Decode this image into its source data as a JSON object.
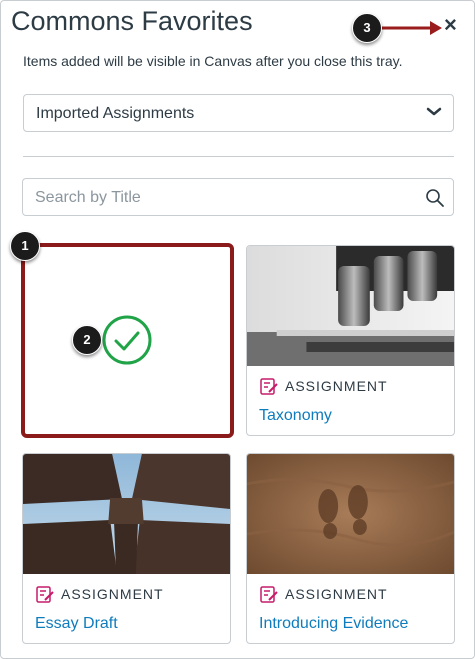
{
  "tray": {
    "title": "Commons Favorites",
    "subtitle": "Items added will be visible in Canvas after you close this tray.",
    "close_label": "×"
  },
  "filter": {
    "selected": "Imported Assignments"
  },
  "search": {
    "placeholder": "Search by Title",
    "value": ""
  },
  "cards": [
    {
      "type": "ASSIGNMENT",
      "title": "Taxonomy",
      "image": "microscope"
    },
    {
      "type": "ASSIGNMENT",
      "title": "Essay Draft",
      "image": "building-sky"
    },
    {
      "type": "ASSIGNMENT",
      "title": "Introducing Evidence",
      "image": "footprints-sand"
    }
  ],
  "selected_card": {
    "state": "checked"
  },
  "callouts": [
    "1",
    "2",
    "3"
  ],
  "colors": {
    "accent": "#8b1a1a",
    "link": "#0e7cbd",
    "check": "#21a348",
    "assignment_icon": "#c61c6a"
  }
}
